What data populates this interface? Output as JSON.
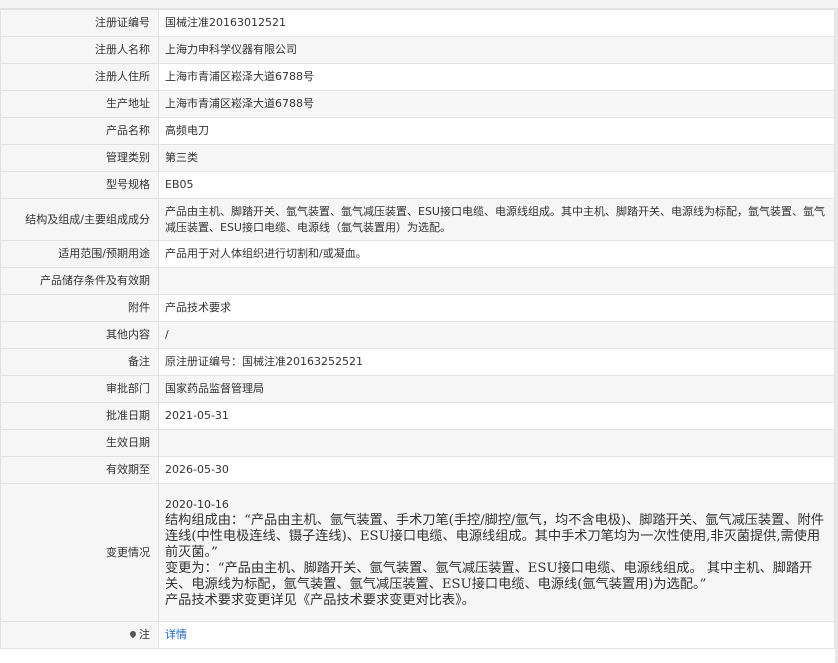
{
  "fields": [
    {
      "label": "注册证编号",
      "value": "国械注准20163012521"
    },
    {
      "label": "注册人名称",
      "value": "上海力申科学仪器有限公司"
    },
    {
      "label": "注册人住所",
      "value": "上海市青浦区崧泽大道6788号"
    },
    {
      "label": "生产地址",
      "value": "上海市青浦区崧泽大道6788号"
    },
    {
      "label": "产品名称",
      "value": "高频电刀"
    },
    {
      "label": "管理类别",
      "value": "第三类"
    },
    {
      "label": "型号规格",
      "value": "EB05"
    },
    {
      "label": "结构及组成/主要组成成分",
      "value": "产品由主机、脚踏开关、氩气装置、氩气减压装置、ESU接口电缆、电源线组成。其中主机、脚踏开关、电源线为标配，氩气装置、氩气减压装置、ESU接口电缆、电源线（氩气装置用）为选配。"
    },
    {
      "label": "适用范围/预期用途",
      "value": "产品用于对人体组织进行切割和/或凝血。"
    },
    {
      "label": "产品储存条件及有效期",
      "value": ""
    },
    {
      "label": "附件",
      "value": "产品技术要求"
    },
    {
      "label": "其他内容",
      "value": "/"
    },
    {
      "label": "备注",
      "value": "原注册证编号：国械注准20163252521"
    },
    {
      "label": "审批部门",
      "value": "国家药品监督管理局"
    },
    {
      "label": "批准日期",
      "value": "2021-05-31"
    },
    {
      "label": "生效日期",
      "value": ""
    },
    {
      "label": "有效期至",
      "value": "2026-05-30"
    }
  ],
  "change": {
    "label": "变更情况",
    "date": "2020-10-16",
    "line1": "结构组成由：“产品由主机、氩气装置、手术刀笔(手控/脚控/氩气，均不含电极)、脚踏开关、氩气减压装置、附件连线(中性电极连线、镊子连线)、ESU接口电缆、电源线组成。其中手术刀笔均为一次性使用,非灭菌提供,需使用前灭菌。”",
    "line2": "变更为：“产品由主机、脚踏开关、氩气装置、氩气减压装置、ESU接口电缆、电源线组成。 其中主机、脚踏开关、电源线为标配，氩气装置、氩气减压装置、ESU接口电缆、电源线(氩气装置用)为选配。”",
    "line3": "产品技术要求变更详见《产品技术要求变更对比表》。"
  },
  "note": {
    "label": "注",
    "link": "详情"
  }
}
